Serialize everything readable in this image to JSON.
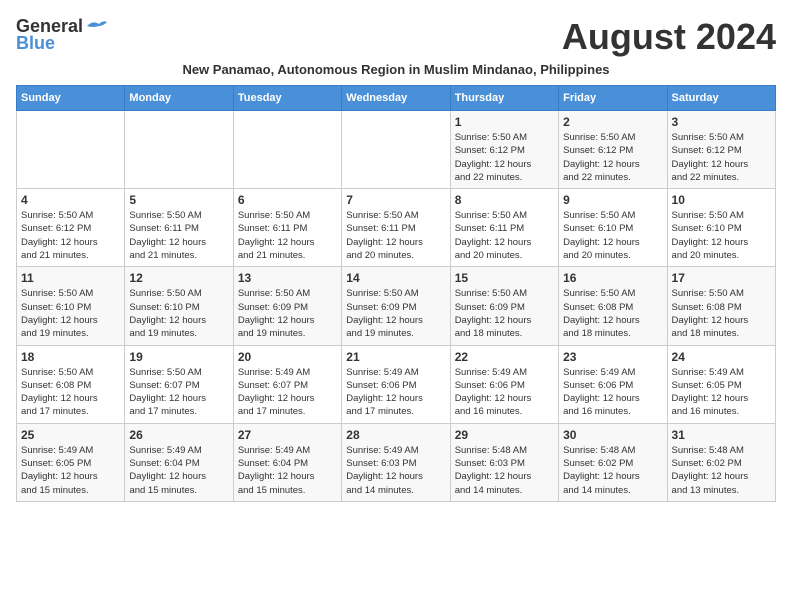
{
  "logo": {
    "general": "General",
    "blue": "Blue"
  },
  "title": "August 2024",
  "subtitle": "New Panamao, Autonomous Region in Muslim Mindanao, Philippines",
  "days_of_week": [
    "Sunday",
    "Monday",
    "Tuesday",
    "Wednesday",
    "Thursday",
    "Friday",
    "Saturday"
  ],
  "weeks": [
    [
      {
        "num": "",
        "info": ""
      },
      {
        "num": "",
        "info": ""
      },
      {
        "num": "",
        "info": ""
      },
      {
        "num": "",
        "info": ""
      },
      {
        "num": "1",
        "info": "Sunrise: 5:50 AM\nSunset: 6:12 PM\nDaylight: 12 hours\nand 22 minutes."
      },
      {
        "num": "2",
        "info": "Sunrise: 5:50 AM\nSunset: 6:12 PM\nDaylight: 12 hours\nand 22 minutes."
      },
      {
        "num": "3",
        "info": "Sunrise: 5:50 AM\nSunset: 6:12 PM\nDaylight: 12 hours\nand 22 minutes."
      }
    ],
    [
      {
        "num": "4",
        "info": "Sunrise: 5:50 AM\nSunset: 6:12 PM\nDaylight: 12 hours\nand 21 minutes."
      },
      {
        "num": "5",
        "info": "Sunrise: 5:50 AM\nSunset: 6:11 PM\nDaylight: 12 hours\nand 21 minutes."
      },
      {
        "num": "6",
        "info": "Sunrise: 5:50 AM\nSunset: 6:11 PM\nDaylight: 12 hours\nand 21 minutes."
      },
      {
        "num": "7",
        "info": "Sunrise: 5:50 AM\nSunset: 6:11 PM\nDaylight: 12 hours\nand 20 minutes."
      },
      {
        "num": "8",
        "info": "Sunrise: 5:50 AM\nSunset: 6:11 PM\nDaylight: 12 hours\nand 20 minutes."
      },
      {
        "num": "9",
        "info": "Sunrise: 5:50 AM\nSunset: 6:10 PM\nDaylight: 12 hours\nand 20 minutes."
      },
      {
        "num": "10",
        "info": "Sunrise: 5:50 AM\nSunset: 6:10 PM\nDaylight: 12 hours\nand 20 minutes."
      }
    ],
    [
      {
        "num": "11",
        "info": "Sunrise: 5:50 AM\nSunset: 6:10 PM\nDaylight: 12 hours\nand 19 minutes."
      },
      {
        "num": "12",
        "info": "Sunrise: 5:50 AM\nSunset: 6:10 PM\nDaylight: 12 hours\nand 19 minutes."
      },
      {
        "num": "13",
        "info": "Sunrise: 5:50 AM\nSunset: 6:09 PM\nDaylight: 12 hours\nand 19 minutes."
      },
      {
        "num": "14",
        "info": "Sunrise: 5:50 AM\nSunset: 6:09 PM\nDaylight: 12 hours\nand 19 minutes."
      },
      {
        "num": "15",
        "info": "Sunrise: 5:50 AM\nSunset: 6:09 PM\nDaylight: 12 hours\nand 18 minutes."
      },
      {
        "num": "16",
        "info": "Sunrise: 5:50 AM\nSunset: 6:08 PM\nDaylight: 12 hours\nand 18 minutes."
      },
      {
        "num": "17",
        "info": "Sunrise: 5:50 AM\nSunset: 6:08 PM\nDaylight: 12 hours\nand 18 minutes."
      }
    ],
    [
      {
        "num": "18",
        "info": "Sunrise: 5:50 AM\nSunset: 6:08 PM\nDaylight: 12 hours\nand 17 minutes."
      },
      {
        "num": "19",
        "info": "Sunrise: 5:50 AM\nSunset: 6:07 PM\nDaylight: 12 hours\nand 17 minutes."
      },
      {
        "num": "20",
        "info": "Sunrise: 5:49 AM\nSunset: 6:07 PM\nDaylight: 12 hours\nand 17 minutes."
      },
      {
        "num": "21",
        "info": "Sunrise: 5:49 AM\nSunset: 6:06 PM\nDaylight: 12 hours\nand 17 minutes."
      },
      {
        "num": "22",
        "info": "Sunrise: 5:49 AM\nSunset: 6:06 PM\nDaylight: 12 hours\nand 16 minutes."
      },
      {
        "num": "23",
        "info": "Sunrise: 5:49 AM\nSunset: 6:06 PM\nDaylight: 12 hours\nand 16 minutes."
      },
      {
        "num": "24",
        "info": "Sunrise: 5:49 AM\nSunset: 6:05 PM\nDaylight: 12 hours\nand 16 minutes."
      }
    ],
    [
      {
        "num": "25",
        "info": "Sunrise: 5:49 AM\nSunset: 6:05 PM\nDaylight: 12 hours\nand 15 minutes."
      },
      {
        "num": "26",
        "info": "Sunrise: 5:49 AM\nSunset: 6:04 PM\nDaylight: 12 hours\nand 15 minutes."
      },
      {
        "num": "27",
        "info": "Sunrise: 5:49 AM\nSunset: 6:04 PM\nDaylight: 12 hours\nand 15 minutes."
      },
      {
        "num": "28",
        "info": "Sunrise: 5:49 AM\nSunset: 6:03 PM\nDaylight: 12 hours\nand 14 minutes."
      },
      {
        "num": "29",
        "info": "Sunrise: 5:48 AM\nSunset: 6:03 PM\nDaylight: 12 hours\nand 14 minutes."
      },
      {
        "num": "30",
        "info": "Sunrise: 5:48 AM\nSunset: 6:02 PM\nDaylight: 12 hours\nand 14 minutes."
      },
      {
        "num": "31",
        "info": "Sunrise: 5:48 AM\nSunset: 6:02 PM\nDaylight: 12 hours\nand 13 minutes."
      }
    ]
  ]
}
